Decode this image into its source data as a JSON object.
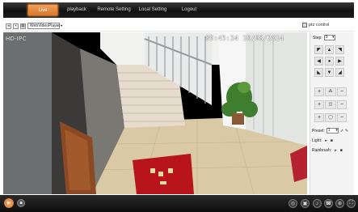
{
  "nav": {
    "tabs": [
      {
        "label": "Live",
        "active": true
      },
      {
        "label": "playback",
        "active": false
      },
      {
        "label": "Remote Setting",
        "active": false
      },
      {
        "label": "Local Setting",
        "active": false
      },
      {
        "label": "Logout",
        "active": false
      }
    ]
  },
  "toolbar": {
    "player_select": "WebVideoPlayer"
  },
  "ptz": {
    "title": "ptz control",
    "step_label": "Step:",
    "step_value": "5",
    "preset_label": "Preset:",
    "preset_value": "1",
    "light_label": "Light:",
    "rainbrush_label": "Rainbrush:"
  },
  "video": {
    "osd_label": "HD-IPC",
    "osd_time": "09:45:34 10/08/2014"
  },
  "colors": {
    "accent": "#e0843a",
    "nav_bg": "#111111",
    "door_mat": "#b8141c"
  },
  "icons": {
    "ptz": [
      "arrow-up-left-icon",
      "arrow-up-icon",
      "arrow-up-right-icon",
      "arrow-left-icon",
      "center-icon",
      "arrow-right-icon",
      "arrow-down-left-icon",
      "arrow-down-icon",
      "arrow-down-right-icon"
    ],
    "bottom": [
      "snapshot-icon",
      "record-icon",
      "audio-icon",
      "talk-icon",
      "zoom-icon",
      "fullscreen-icon"
    ]
  }
}
